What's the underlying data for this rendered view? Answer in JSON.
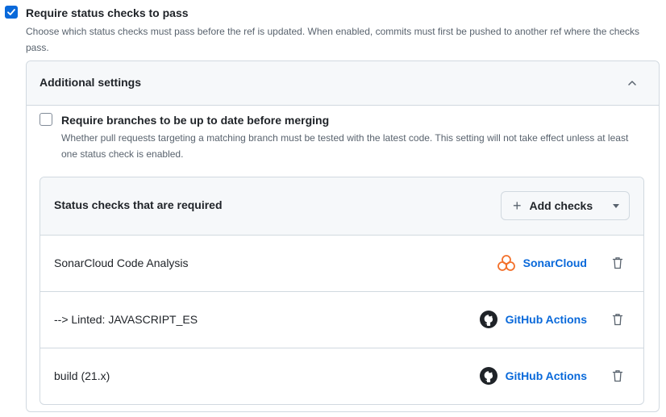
{
  "main": {
    "title": "Require status checks to pass",
    "description": "Choose which status checks must pass before the ref is updated. When enabled, commits must first be pushed to another ref where the checks pass.",
    "checked": true
  },
  "additional_settings": {
    "title": "Additional settings",
    "expanded": true,
    "up_to_date": {
      "title": "Require branches to be up to date before merging",
      "description": "Whether pull requests targeting a matching branch must be tested with the latest code. This setting will not take effect unless at least one status check is enabled.",
      "checked": false
    }
  },
  "status_checks": {
    "title": "Status checks that are required",
    "add_button": "Add checks",
    "rows": [
      {
        "name": "SonarCloud Code Analysis",
        "app": "SonarCloud",
        "icon": "sonarcloud-icon"
      },
      {
        "name": "--> Linted: JAVASCRIPT_ES",
        "app": "GitHub Actions",
        "icon": "github-icon"
      },
      {
        "name": "build (21.x)",
        "app": "GitHub Actions",
        "icon": "github-icon"
      }
    ]
  },
  "colors": {
    "accent": "#0969da",
    "sonarcloud": "#f3702a",
    "border": "#d1d9e0",
    "muted_text": "#59636e"
  }
}
